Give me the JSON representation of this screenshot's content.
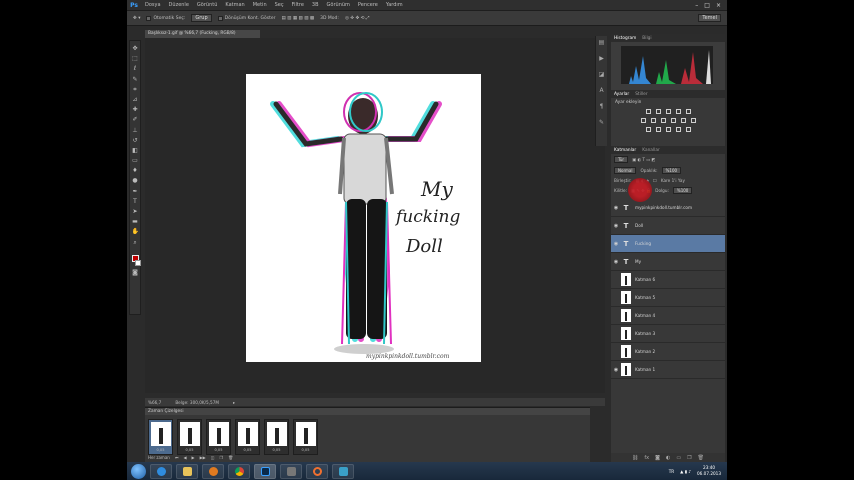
{
  "menubar": {
    "logo": "Ps",
    "items": [
      "Dosya",
      "Düzenle",
      "Görüntü",
      "Katman",
      "Metin",
      "Seç",
      "Filtre",
      "3B",
      "Görünüm",
      "Pencere",
      "Yardım"
    ],
    "window_controls": [
      "–",
      "□",
      "×"
    ]
  },
  "options_bar": {
    "auto_select_label": "Otomatik Seç:",
    "auto_select_value": "Grup",
    "transform_label": "Dönüşüm Kont. Göster",
    "mode_label": "3D Mod:",
    "workspace": "Temel"
  },
  "document": {
    "tab_title": "Başlıksız-1.gif @ %66,7 (Fucking, RGB/8)",
    "artwork_caption": [
      "My",
      "fucking",
      "Doll"
    ],
    "watermark": "mypinkpinkdoll.tumblr.com"
  },
  "status_bar": {
    "zoom": "%66,7",
    "doc_size": "Belge: 300,0K/5,57M"
  },
  "timeline": {
    "title": "Zaman Çizelgesi",
    "frames": [
      {
        "delay": "0,05"
      },
      {
        "delay": "0,05"
      },
      {
        "delay": "0,05"
      },
      {
        "delay": "0,05"
      },
      {
        "delay": "0,05"
      },
      {
        "delay": "0,05"
      }
    ],
    "loop": "Her zaman"
  },
  "histogram_panel": {
    "tabs": [
      "Histogram",
      "Bilgi"
    ]
  },
  "adjustments_panel": {
    "tabs": [
      "Ayarlar",
      "Stiller"
    ],
    "subtitle": "Ayar ekleyin"
  },
  "layers_panel": {
    "tabs": [
      "Katmanlar",
      "Kanallar"
    ],
    "filter_label": "Tür",
    "blend_mode": "Normal",
    "opacity_label": "Opaklık:",
    "opacity_value": "%100",
    "lock_label": "Kilitle:",
    "fill_label": "Dolgu:",
    "fill_value": "%100",
    "propagate_label": "Kare 1'i Yay",
    "unify_label": "Birleştir:",
    "layers": [
      {
        "name": "mypinkpinkdoll.tumblr.com",
        "type": "text",
        "visible": true,
        "selected": false
      },
      {
        "name": "Doll",
        "type": "text",
        "visible": true,
        "selected": false
      },
      {
        "name": "Fucking",
        "type": "text",
        "visible": true,
        "selected": true
      },
      {
        "name": "My",
        "type": "text",
        "visible": true,
        "selected": false
      },
      {
        "name": "Katman 6",
        "type": "image",
        "visible": false,
        "selected": false
      },
      {
        "name": "Katman 5",
        "type": "image",
        "visible": false,
        "selected": false
      },
      {
        "name": "Katman 4",
        "type": "image",
        "visible": false,
        "selected": false
      },
      {
        "name": "Katman 3",
        "type": "image",
        "visible": false,
        "selected": false
      },
      {
        "name": "Katman 2",
        "type": "image",
        "visible": false,
        "selected": false
      },
      {
        "name": "Katman 1",
        "type": "image",
        "visible": true,
        "selected": false
      }
    ]
  },
  "taskbar": {
    "apps": [
      "internet-explorer",
      "file-explorer",
      "media-player",
      "chrome",
      "photoshop",
      "camera",
      "loader",
      "network"
    ],
    "active_app": "photoshop",
    "lang": "TR",
    "time": "23:40",
    "date": "06.07.2013"
  },
  "colors": {
    "foreground": "#c00000",
    "background": "#ffffff",
    "selection": "#5a7aa4"
  }
}
